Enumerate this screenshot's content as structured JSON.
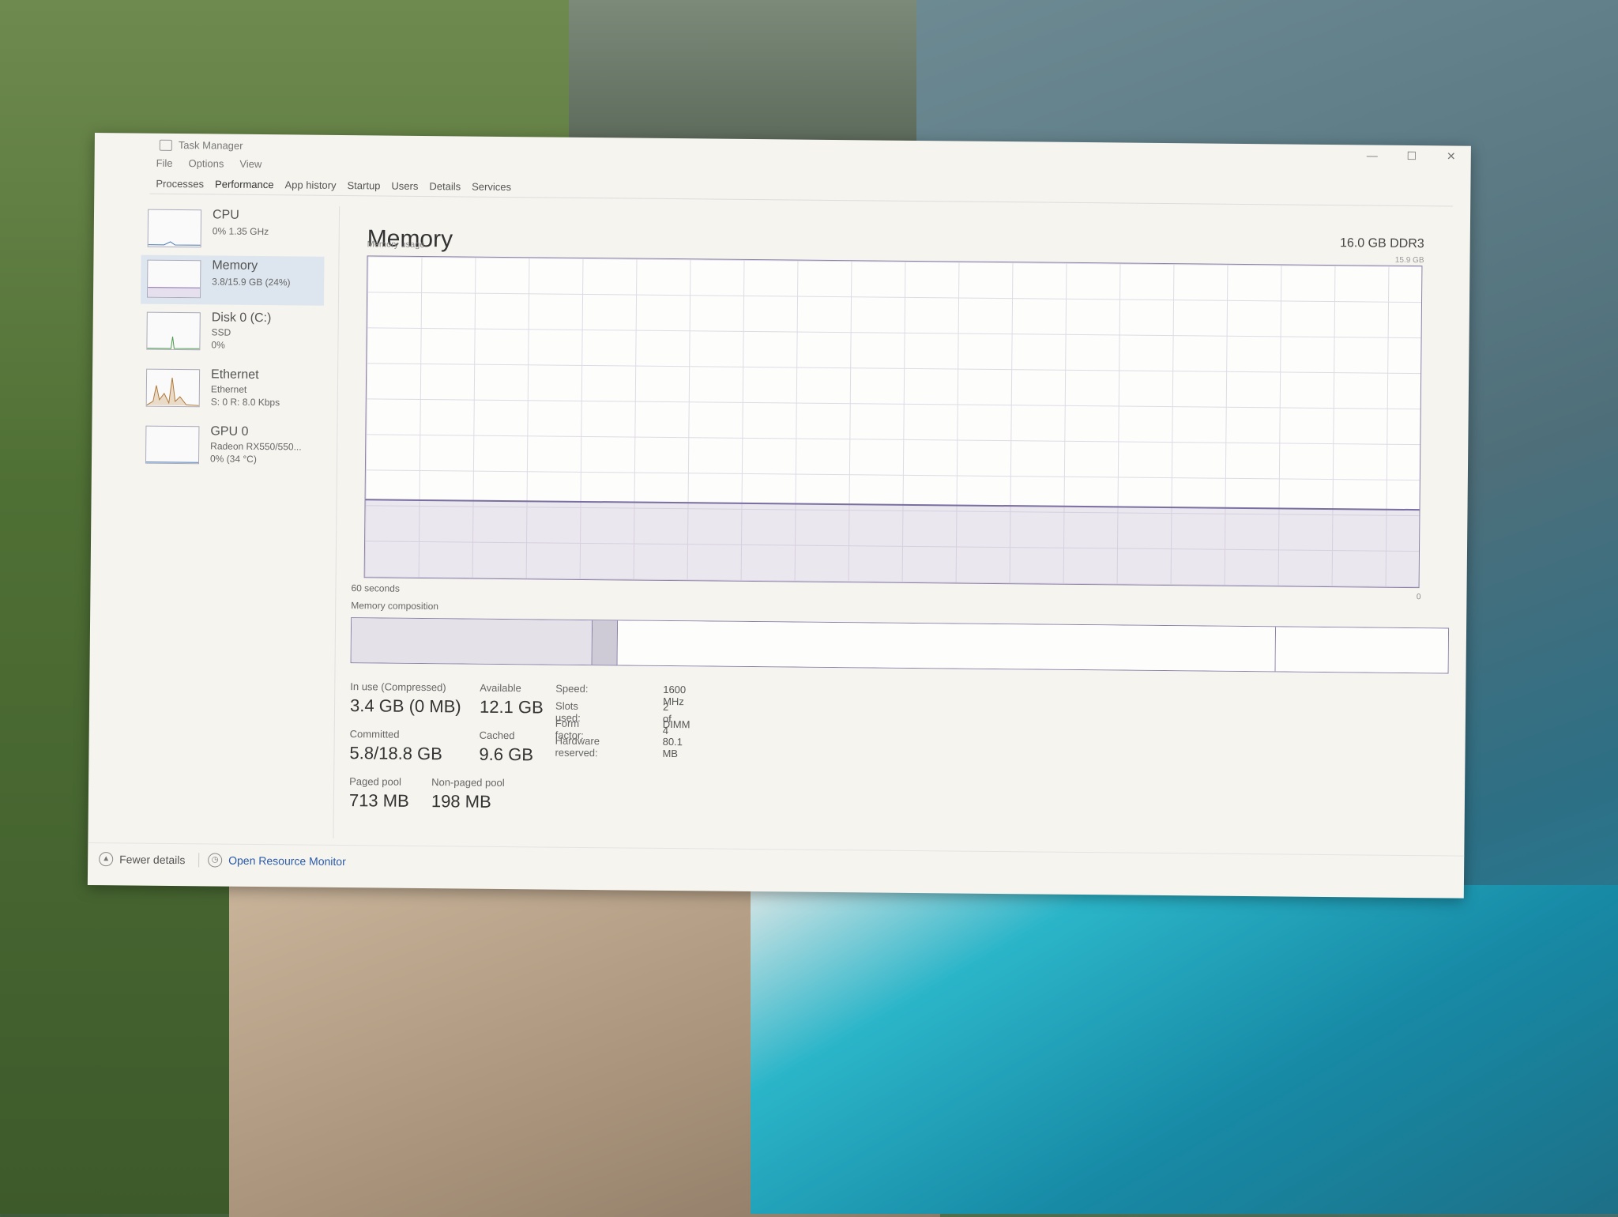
{
  "window": {
    "title": "Task Manager",
    "controls": {
      "minimize": "—",
      "maximize": "☐",
      "close": "✕"
    }
  },
  "menu": [
    "File",
    "Options",
    "View"
  ],
  "tabs": [
    {
      "label": "Processes",
      "active": false
    },
    {
      "label": "Performance",
      "active": true
    },
    {
      "label": "App history",
      "active": false
    },
    {
      "label": "Startup",
      "active": false
    },
    {
      "label": "Users",
      "active": false
    },
    {
      "label": "Details",
      "active": false
    },
    {
      "label": "Services",
      "active": false
    }
  ],
  "sidebar": {
    "items": [
      {
        "name": "CPU",
        "sub1": "0% 1.35 GHz",
        "sub2": "",
        "sub3": "",
        "selected": false
      },
      {
        "name": "Memory",
        "sub1": "3.8/15.9 GB (24%)",
        "sub2": "",
        "sub3": "",
        "selected": true
      },
      {
        "name": "Disk 0 (C:)",
        "sub1": "SSD",
        "sub2": "0%",
        "sub3": "",
        "selected": false
      },
      {
        "name": "Ethernet",
        "sub1": "Ethernet",
        "sub2": "S: 0 R: 8.0 Kbps",
        "sub3": "",
        "selected": false
      },
      {
        "name": "GPU 0",
        "sub1": "Radeon RX550/550...",
        "sub2": "0% (34 °C)",
        "sub3": "",
        "selected": false
      }
    ]
  },
  "main": {
    "title": "Memory",
    "spec": "16.0 GB DDR3",
    "usage_label": "Memory usage",
    "usage_max": "15.9 GB",
    "usage_fraction": 0.24,
    "axis_left": "60 seconds",
    "axis_right": "0",
    "composition_label": "Memory composition",
    "composition": {
      "in_use": 0.22,
      "modified": 0.023,
      "standby": 0.6,
      "free": 0.157
    }
  },
  "stats": {
    "in_use": {
      "label": "In use (Compressed)",
      "value": "3.4 GB (0 MB)"
    },
    "available": {
      "label": "Available",
      "value": "12.1 GB"
    },
    "committed": {
      "label": "Committed",
      "value": "5.8/18.8 GB"
    },
    "cached": {
      "label": "Cached",
      "value": "9.6 GB"
    },
    "paged_pool": {
      "label": "Paged pool",
      "value": "713 MB"
    },
    "nonpaged_pool": {
      "label": "Non-paged pool",
      "value": "198 MB"
    }
  },
  "properties": [
    {
      "key": "Speed:",
      "value": "1600 MHz"
    },
    {
      "key": "Slots used:",
      "value": "2 of 4"
    },
    {
      "key": "Form factor:",
      "value": "DIMM"
    },
    {
      "key": "Hardware reserved:",
      "value": "80.1 MB"
    }
  ],
  "footer": {
    "fewer_details": "Fewer details",
    "resource_monitor": "Open Resource Monitor"
  }
}
